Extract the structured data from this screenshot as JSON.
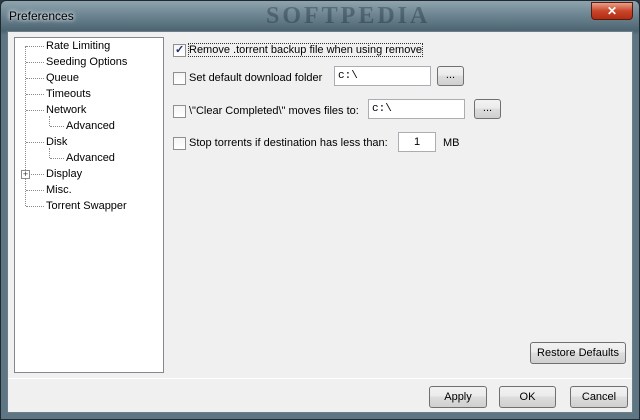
{
  "window": {
    "title": "Preferences",
    "watermark": "SOFTPEDIA",
    "close_glyph": "✕"
  },
  "tree": {
    "items": [
      {
        "label": "Rate Limiting"
      },
      {
        "label": "Seeding Options"
      },
      {
        "label": "Queue"
      },
      {
        "label": "Timeouts"
      },
      {
        "label": "Network"
      },
      {
        "label": "Advanced"
      },
      {
        "label": "Disk"
      },
      {
        "label": "Advanced"
      },
      {
        "label": "Display"
      },
      {
        "label": "Misc."
      },
      {
        "label": "Torrent Swapper"
      }
    ],
    "display_expander": "+"
  },
  "disk": {
    "remove_backup": {
      "label": "Remove .torrent backup file when using remove",
      "checked": true
    },
    "default_folder": {
      "label": "Set default download folder",
      "checked": false,
      "value": "c:\\",
      "browse_label": "..."
    },
    "clear_completed": {
      "label": "\\\"Clear Completed\\\" moves files to:",
      "checked": false,
      "value": "c:\\",
      "browse_label": "..."
    },
    "stop_torrents": {
      "label": "Stop torrents if destination has less than:",
      "checked": false,
      "value": "1",
      "unit": "MB"
    }
  },
  "buttons": {
    "restore_defaults": "Restore Defaults",
    "apply": "Apply",
    "ok": "OK",
    "cancel": "Cancel"
  }
}
